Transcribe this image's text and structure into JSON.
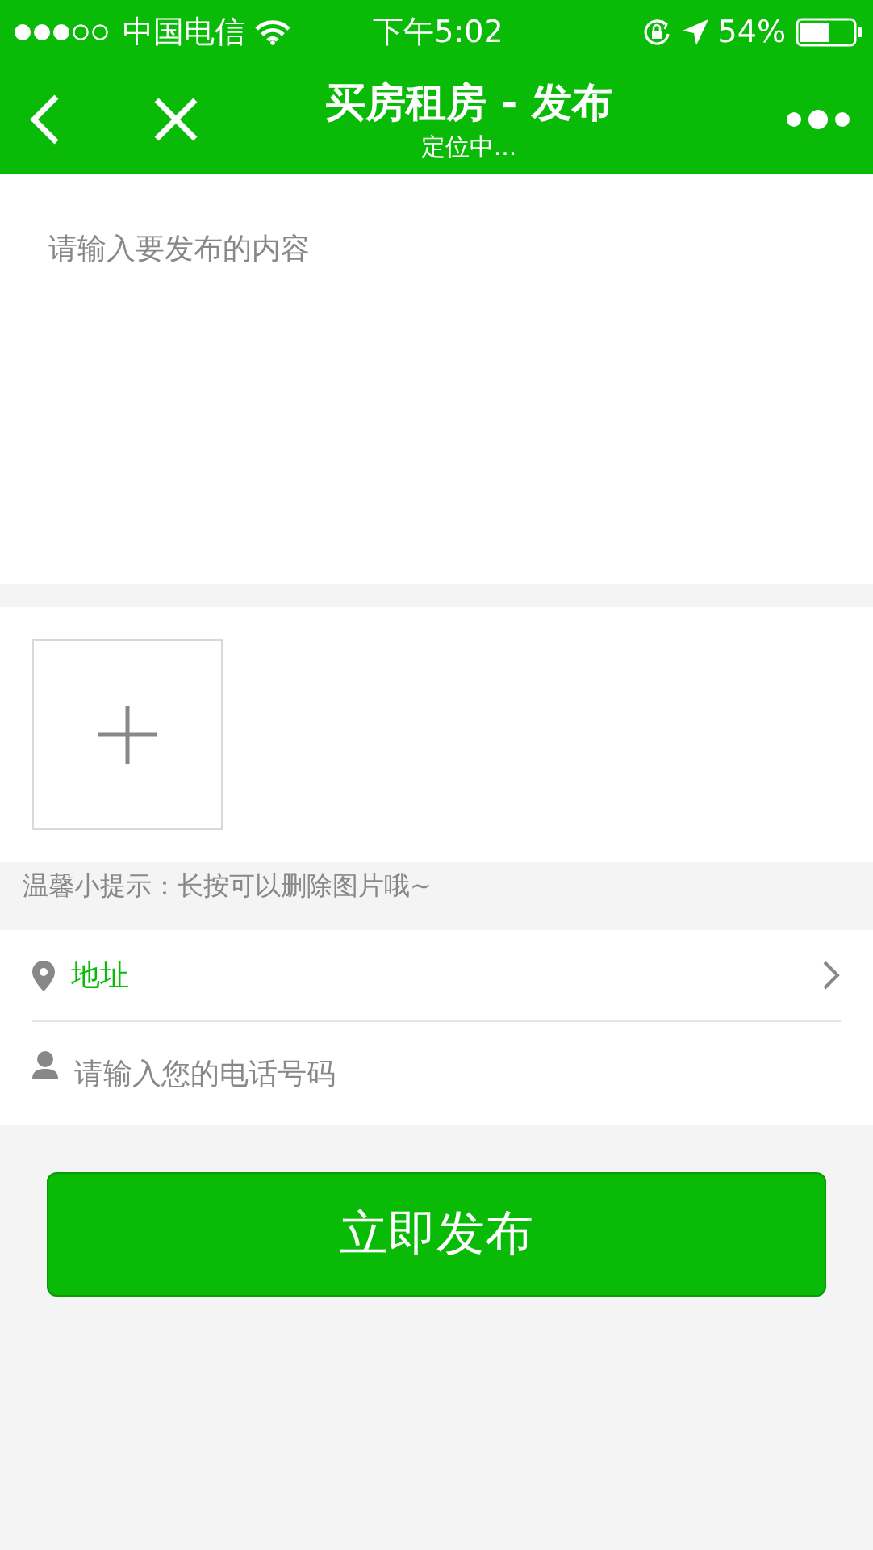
{
  "status_bar": {
    "carrier": "中国电信",
    "time": "下午5:02",
    "battery": "54%"
  },
  "nav": {
    "title": "买房租房 - 发布",
    "subtitle": "定位中..."
  },
  "content": {
    "placeholder": "请输入要发布的内容"
  },
  "tip": "温馨小提示：长按可以删除图片哦~",
  "address": {
    "label": "地址"
  },
  "phone": {
    "placeholder": "请输入您的电话号码"
  },
  "submit": "立即发布"
}
